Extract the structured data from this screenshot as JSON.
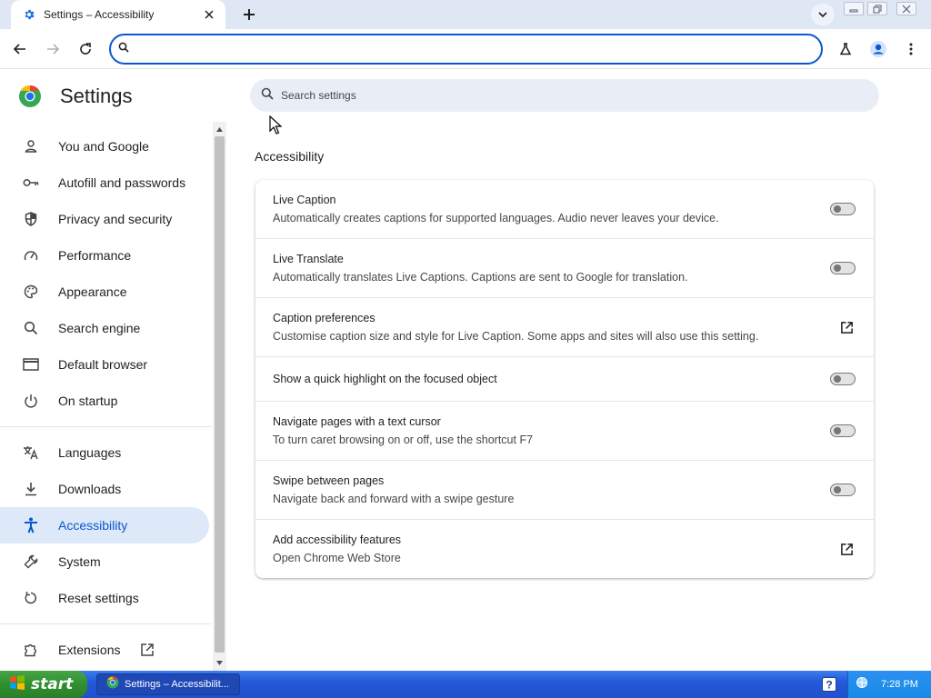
{
  "tab": {
    "title": "Settings – Accessibility"
  },
  "omnibox": {
    "value": "",
    "placeholder": ""
  },
  "settings": {
    "title": "Settings",
    "search_placeholder": "Search settings"
  },
  "sidebar": {
    "items": [
      {
        "label": "You and Google",
        "icon": "person-icon"
      },
      {
        "label": "Autofill and passwords",
        "icon": "key-icon"
      },
      {
        "label": "Privacy and security",
        "icon": "shield-icon"
      },
      {
        "label": "Performance",
        "icon": "speedometer-icon"
      },
      {
        "label": "Appearance",
        "icon": "palette-icon"
      },
      {
        "label": "Search engine",
        "icon": "search-icon"
      },
      {
        "label": "Default browser",
        "icon": "browser-window-icon"
      },
      {
        "label": "On startup",
        "icon": "power-icon"
      },
      {
        "label": "Languages",
        "icon": "translate-icon"
      },
      {
        "label": "Downloads",
        "icon": "download-icon"
      },
      {
        "label": "Accessibility",
        "icon": "accessibility-icon",
        "active": true
      },
      {
        "label": "System",
        "icon": "wrench-icon"
      },
      {
        "label": "Reset settings",
        "icon": "reset-icon"
      },
      {
        "label": "Extensions",
        "icon": "extension-icon"
      }
    ]
  },
  "main": {
    "section_title": "Accessibility",
    "rows": [
      {
        "title": "Live Caption",
        "subtitle": "Automatically creates captions for supported languages. Audio never leaves your device.",
        "control": "toggle",
        "on": false
      },
      {
        "title": "Live Translate",
        "subtitle": "Automatically translates Live Captions. Captions are sent to Google for translation.",
        "control": "toggle",
        "on": false
      },
      {
        "title": "Caption preferences",
        "subtitle": "Customise caption size and style for Live Caption. Some apps and sites will also use this setting.",
        "control": "external-link"
      },
      {
        "title": "Show a quick highlight on the focused object",
        "subtitle": "",
        "control": "toggle",
        "on": false
      },
      {
        "title": "Navigate pages with a text cursor",
        "subtitle": "To turn caret browsing on or off, use the shortcut F7",
        "control": "toggle",
        "on": false
      },
      {
        "title": "Swipe between pages",
        "subtitle": "Navigate back and forward with a swipe gesture",
        "control": "toggle",
        "on": false
      },
      {
        "title": "Add accessibility features",
        "subtitle": "Open Chrome Web Store",
        "control": "external-link"
      }
    ]
  },
  "taskbar": {
    "start_label": "start",
    "task_label": "Settings – Accessibilit...",
    "time": "7:28 PM"
  },
  "colors": {
    "accent": "#0b57d0",
    "active_nav_bg": "#dde8f8",
    "taskbar_blue": "#245edb",
    "start_green": "#3c9a3c"
  }
}
